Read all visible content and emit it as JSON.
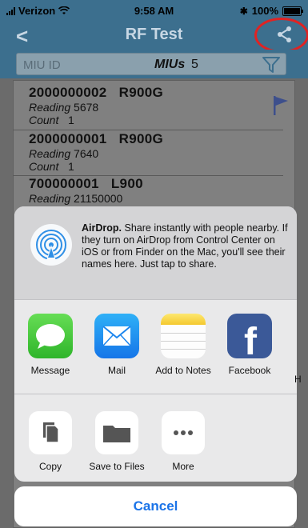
{
  "status_bar": {
    "carrier": "Verizon",
    "time": "9:58 AM",
    "battery": "100%"
  },
  "nav": {
    "back_glyph": "<",
    "title": "RF Test"
  },
  "search": {
    "placeholder": "MIU ID",
    "mius_label": "MIUs",
    "mius_count": "5"
  },
  "list": {
    "items": [
      {
        "id": "2000000002",
        "type": "R900G",
        "reading_label": "Reading",
        "reading": "5678",
        "count_label": "Count",
        "count": "1"
      },
      {
        "id": "2000000001",
        "type": "R900G",
        "reading_label": "Reading",
        "reading": "7640",
        "count_label": "Count",
        "count": "1"
      },
      {
        "id": "700000001",
        "type": "L900",
        "reading_label": "Reading",
        "reading": "21150000"
      }
    ]
  },
  "share_sheet": {
    "airdrop_title": "AirDrop.",
    "airdrop_text": "Share instantly with people nearby. If they turn on AirDrop from Control Center on iOS or from Finder on the Mac, you'll see their names here. Just tap to share.",
    "apps": [
      {
        "label": "Message",
        "icon": "message-icon"
      },
      {
        "label": "Mail",
        "icon": "mail-icon"
      },
      {
        "label": "Add to Notes",
        "icon": "notes-icon"
      },
      {
        "label": "Facebook",
        "icon": "facebook-icon"
      }
    ],
    "peek_label": "H",
    "actions": [
      {
        "label": "Copy",
        "icon": "copy-icon"
      },
      {
        "label": "Save to Files",
        "icon": "folder-icon"
      },
      {
        "label": "More",
        "icon": "more-icon"
      }
    ],
    "cancel_label": "Cancel"
  },
  "colors": {
    "nav_bg": "#3c6f8e",
    "accent_blue": "#1a73e8",
    "highlight_ring": "#e02323"
  }
}
